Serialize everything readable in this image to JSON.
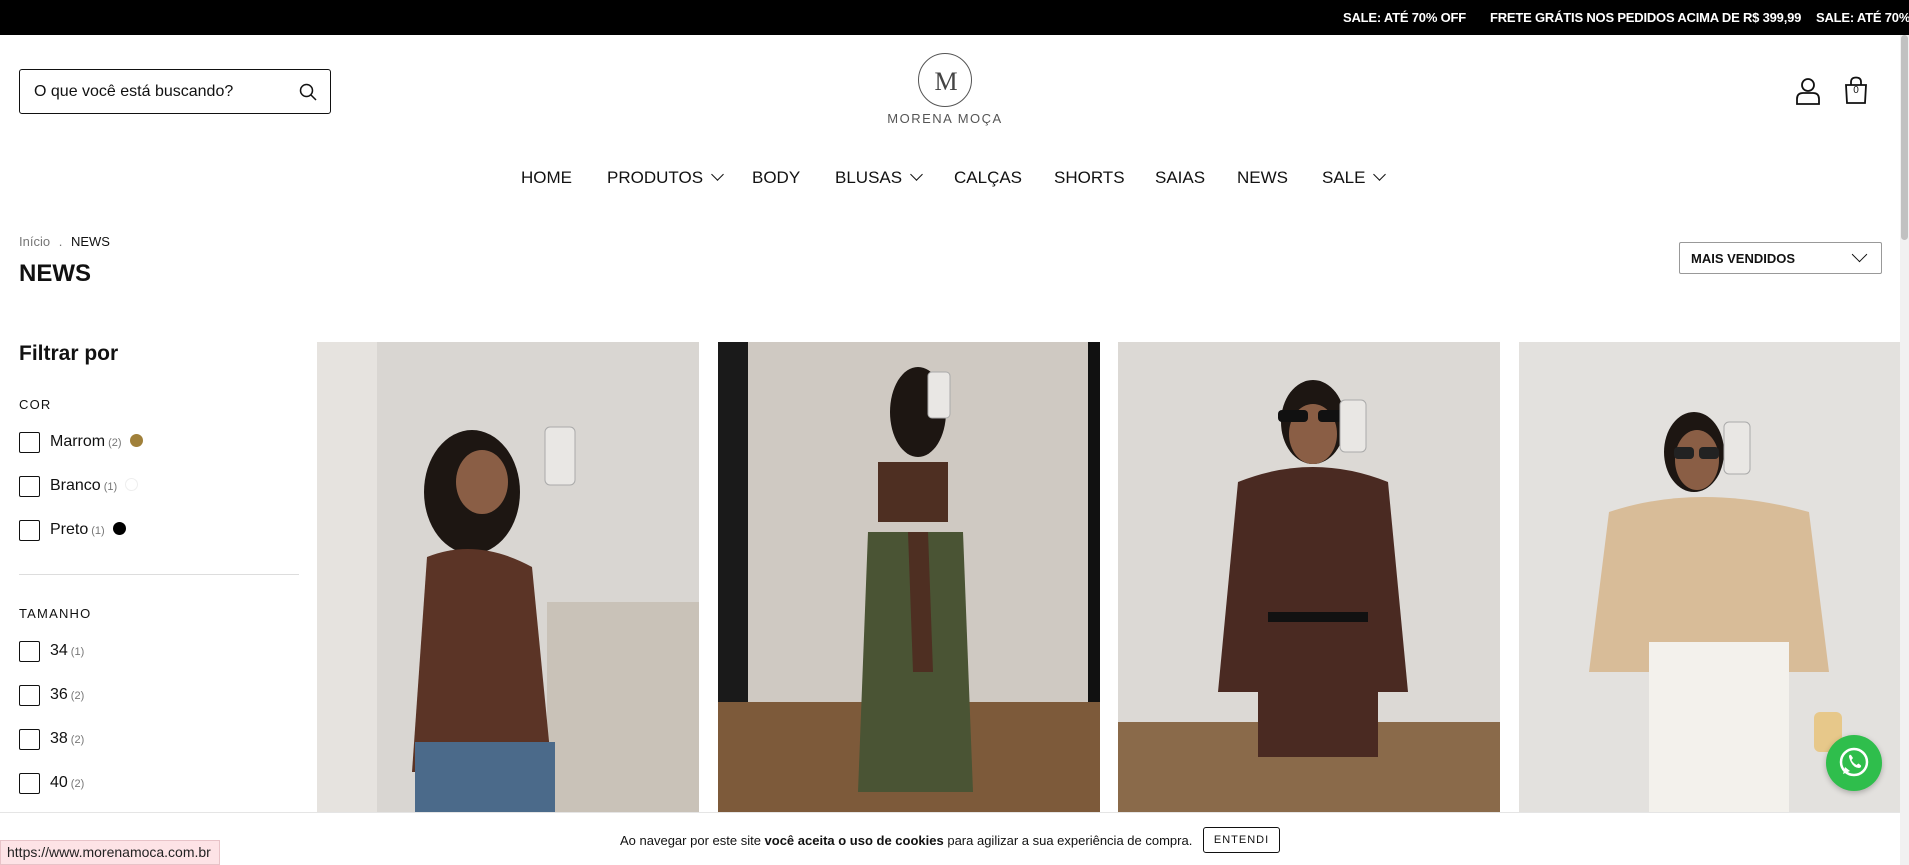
{
  "announcement": {
    "messages": [
      "SALE: ATÉ 70% OFF",
      "FRETE GRÁTIS NOS PEDIDOS ACIMA DE R$ 399,99",
      "SALE: ATÉ 70%"
    ]
  },
  "header": {
    "search_placeholder": "O que você está buscando?",
    "logo_monogram": "M",
    "logo_text": "MORENA MOÇA",
    "cart_count": "0"
  },
  "nav": {
    "items": [
      "HOME",
      "PRODUTOS",
      "BODY",
      "BLUSAS",
      "CALÇAS",
      "SHORTS",
      "SAIAS",
      "NEWS",
      "SALE"
    ]
  },
  "breadcrumb": {
    "home": "Início",
    "sep": ".",
    "current": "NEWS"
  },
  "page": {
    "title": "NEWS"
  },
  "sort": {
    "selected": "MAIS VENDIDOS"
  },
  "filters": {
    "heading": "Filtrar por",
    "color": {
      "label": "COR",
      "options": [
        {
          "name": "Marrom",
          "count": "(2)",
          "swatch": "#a0803a"
        },
        {
          "name": "Branco",
          "count": "(1)",
          "swatch": "#ffffff"
        },
        {
          "name": "Preto",
          "count": "(1)",
          "swatch": "#000000"
        }
      ]
    },
    "size": {
      "label": "TAMANHO",
      "options": [
        {
          "name": "34",
          "count": "(1)"
        },
        {
          "name": "36",
          "count": "(2)"
        },
        {
          "name": "38",
          "count": "(2)"
        },
        {
          "name": "40",
          "count": "(2)"
        }
      ]
    }
  },
  "cookie": {
    "text_before": "Ao navegar por este site ",
    "text_bold": "você aceita o uso de cookies",
    "text_after": " para agilizar a sua experiência de compra.",
    "button": "ENTENDI"
  },
  "status_url": "https://www.morenamoca.com.br",
  "colors": {
    "whatsapp": "#2fbe4c",
    "topbar": "#000000"
  }
}
